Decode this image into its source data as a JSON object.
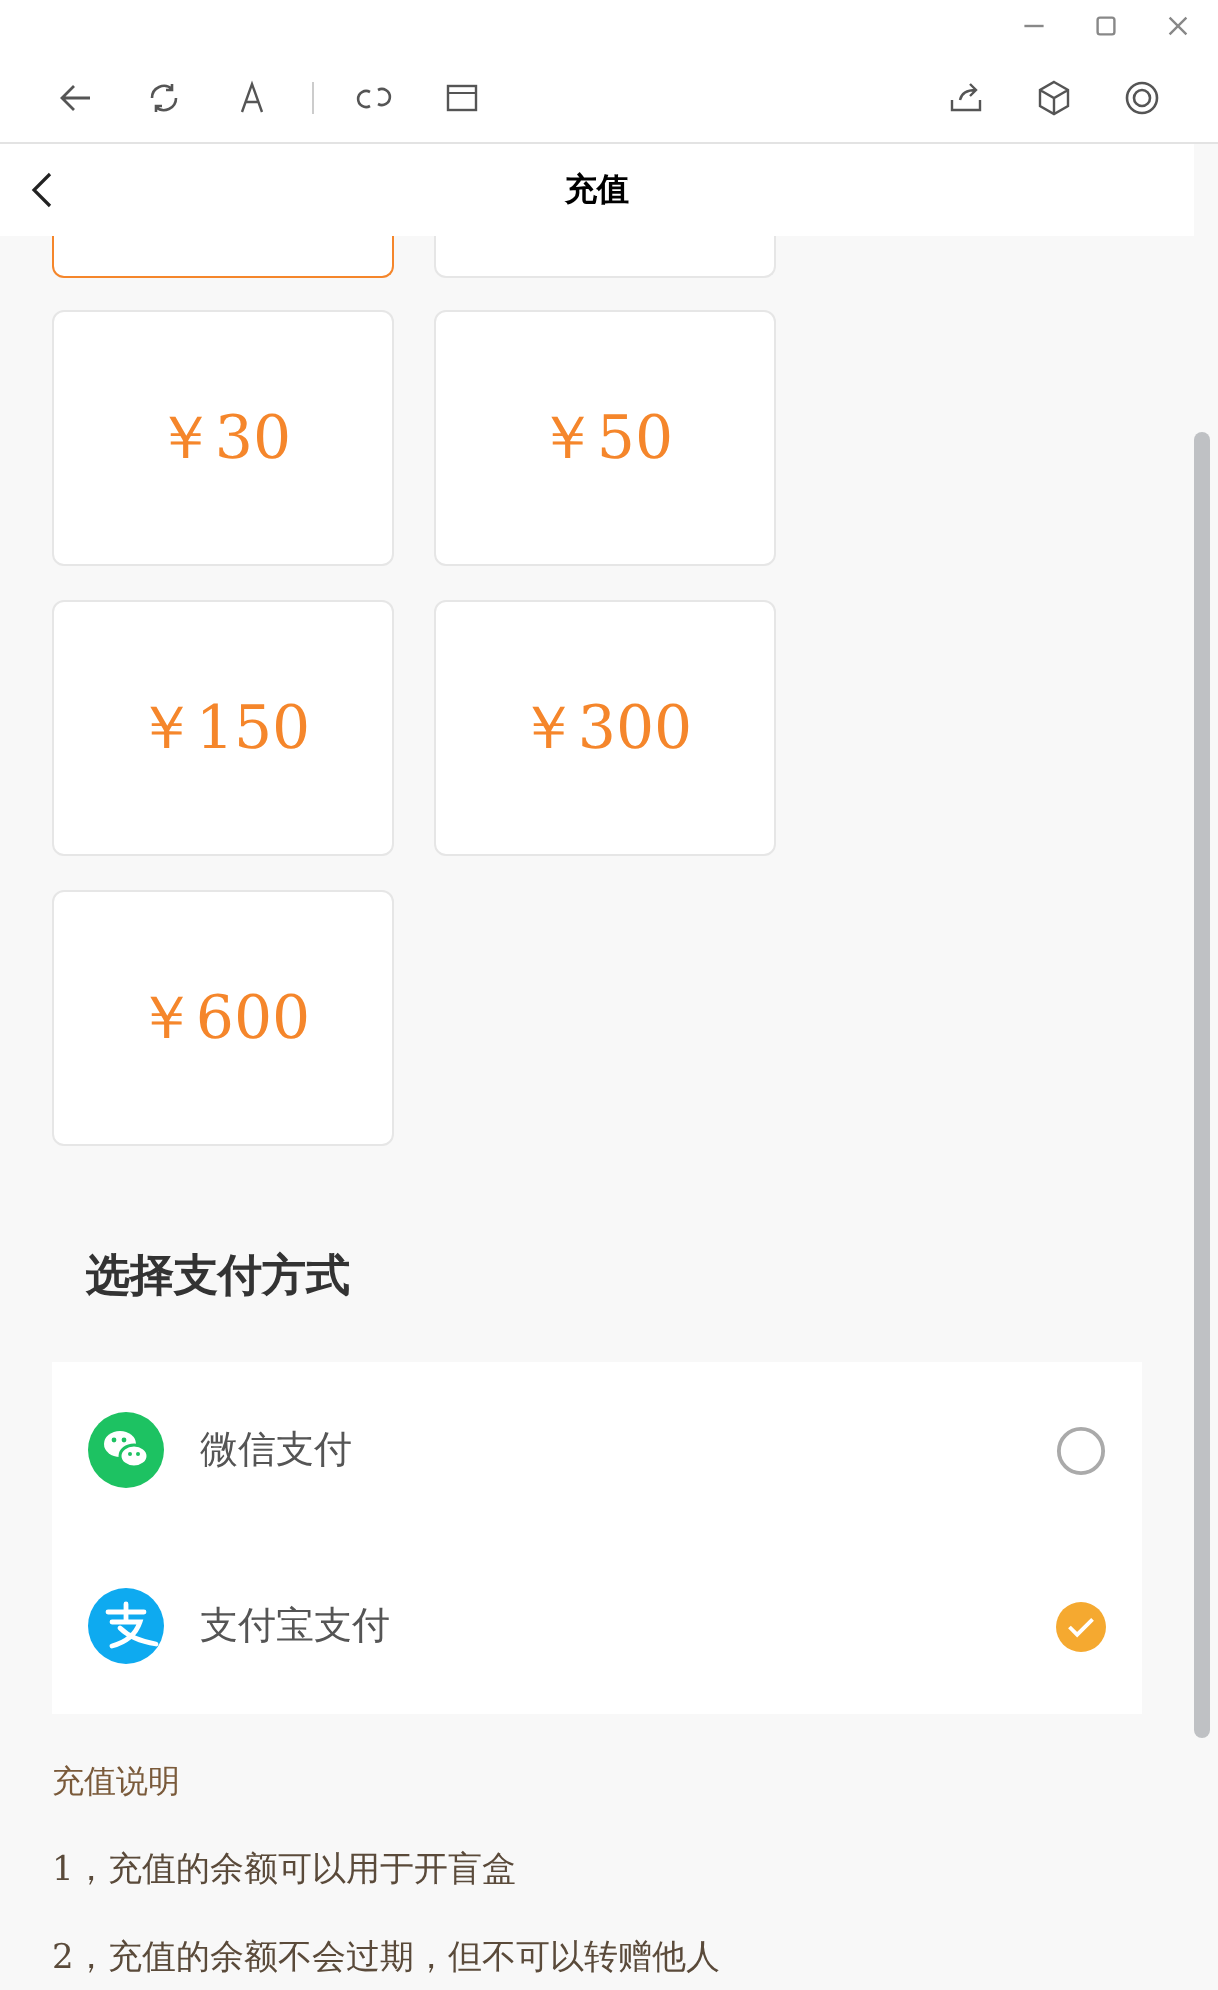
{
  "header": {
    "title": "充值"
  },
  "amounts": [
    {
      "selected": true
    },
    {
      "selected": false
    },
    {
      "amount": "￥30",
      "selected": false
    },
    {
      "amount": "￥50",
      "selected": false
    },
    {
      "amount": "￥150",
      "selected": false
    },
    {
      "amount": "￥300",
      "selected": false
    },
    {
      "amount": "￥600",
      "selected": false
    }
  ],
  "payment": {
    "title": "选择支付方式",
    "methods": [
      {
        "kind": "wechat",
        "label": "微信支付",
        "selected": false
      },
      {
        "kind": "alipay",
        "label": "支付宝支付",
        "selected": true
      }
    ]
  },
  "notes": {
    "title": "充值说明",
    "lines": [
      "1，充值的余额可以用于开盲盒",
      "2，充值的余额不会过期，但不可以转赠他人"
    ]
  }
}
